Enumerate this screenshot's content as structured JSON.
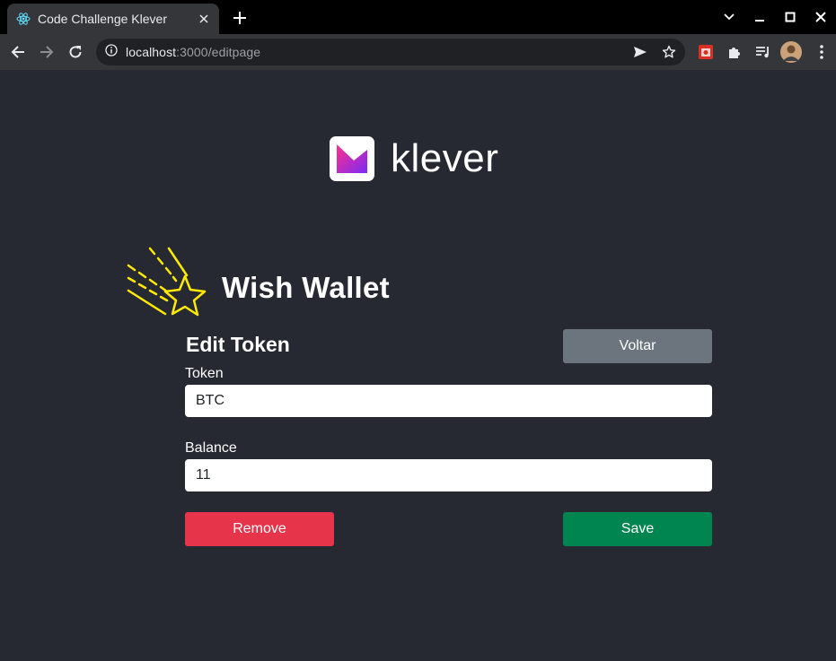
{
  "browser": {
    "tab_title": "Code Challenge Klever",
    "url_host": "localhost",
    "url_path": ":3000/editpage"
  },
  "header": {
    "logo_text": "klever"
  },
  "brand": {
    "title": "Wish Wallet"
  },
  "form": {
    "title": "Edit Token",
    "back_label": "Voltar",
    "token_label": "Token",
    "token_value": "BTC",
    "balance_label": "Balance",
    "balance_value": "11",
    "remove_label": "Remove",
    "save_label": "Save"
  },
  "colors": {
    "background": "#262932",
    "back_button": "#6c757d",
    "remove_button": "#e6354a",
    "save_button": "#008551",
    "star": "#ffea00"
  }
}
